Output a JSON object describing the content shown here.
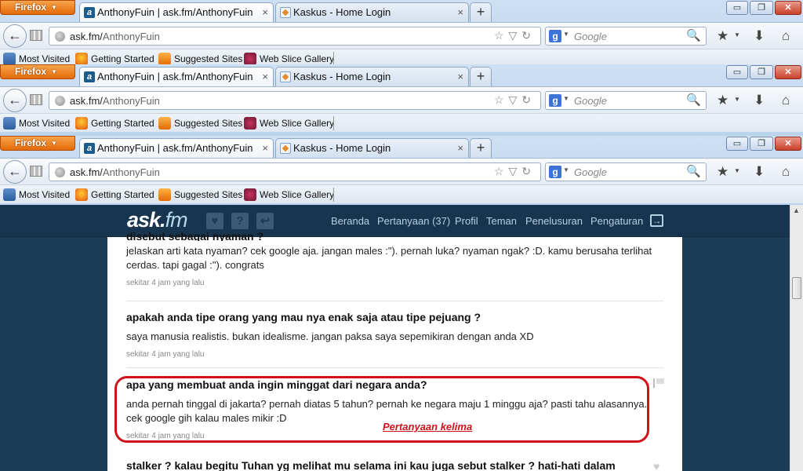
{
  "browser": {
    "menu_label": "Firefox",
    "menu_arrow": "▼",
    "tabs": [
      {
        "title": "AnthonyFuin | ask.fm/AnthonyFuin",
        "favicon_letter": "a",
        "close": "×"
      },
      {
        "title": "Kaskus - Home Login",
        "close": "×"
      }
    ],
    "new_tab": "+",
    "window_controls": {
      "minimize": "▭",
      "maximize": "❐",
      "close": "✕"
    },
    "back": "←",
    "url_host": "ask.fm/",
    "url_path": "AnthonyFuin",
    "url_icons": "☆▽↻",
    "search_engine_letter": "g",
    "search_placeholder": "Google",
    "search_icon": "🔍",
    "toolbar_icons": {
      "bookmarks": "★",
      "dropdown": "▼",
      "download": "⬇",
      "home": "⌂"
    },
    "bookmarks": [
      "Most Visited",
      "Getting Started",
      "Suggested Sites",
      "Web Slice Gallery"
    ]
  },
  "site": {
    "logo_main": "ask.",
    "logo_fm": "fm",
    "header_icons": {
      "heart": "♥",
      "question": "?",
      "reply": "↩"
    },
    "nav": [
      "Beranda",
      "Pertanyaan (37)",
      "Profil",
      "Teman",
      "Penelusuran",
      "Pengaturan"
    ],
    "logout_icon": "→"
  },
  "questions": [
    {
      "question": "disebut sebagai nyaman ?",
      "answer": "jelaskan arti kata nyaman? cek google aja. jangan males :\"). pernah luka? nyaman ngak? :D. kamu berusaha terlihat cerdas. tapi gagal :\"). congrats",
      "time": "sekitar 4 jam yang lalu"
    },
    {
      "question": "apakah anda tipe orang yang mau nya enak saja atau tipe pejuang ?",
      "answer": "saya manusia realistis. bukan idealisme. jangan paksa saya sepemikiran dengan anda XD",
      "time": "sekitar 4 jam yang lalu"
    },
    {
      "question": "apa yang membuat anda ingin minggat dari negara anda?",
      "answer": "anda pernah tinggal di jakarta? pernah diatas 5 tahun? pernah ke negara maju 1 minggu aja? pasti tahu alasannya. cek google gih kalau males mikir :D",
      "time": "sekitar 4 jam yang lalu"
    },
    {
      "question": "stalker ? kalau begitu Tuhan yg melihat mu selama ini kau juga sebut stalker ? hati-hati dalam"
    }
  ],
  "annotation": "Pertanyaan kelima",
  "colors": {
    "highlight": "#d0121b",
    "header_bg": "#17354e",
    "page_bg": "#1c3c56"
  }
}
